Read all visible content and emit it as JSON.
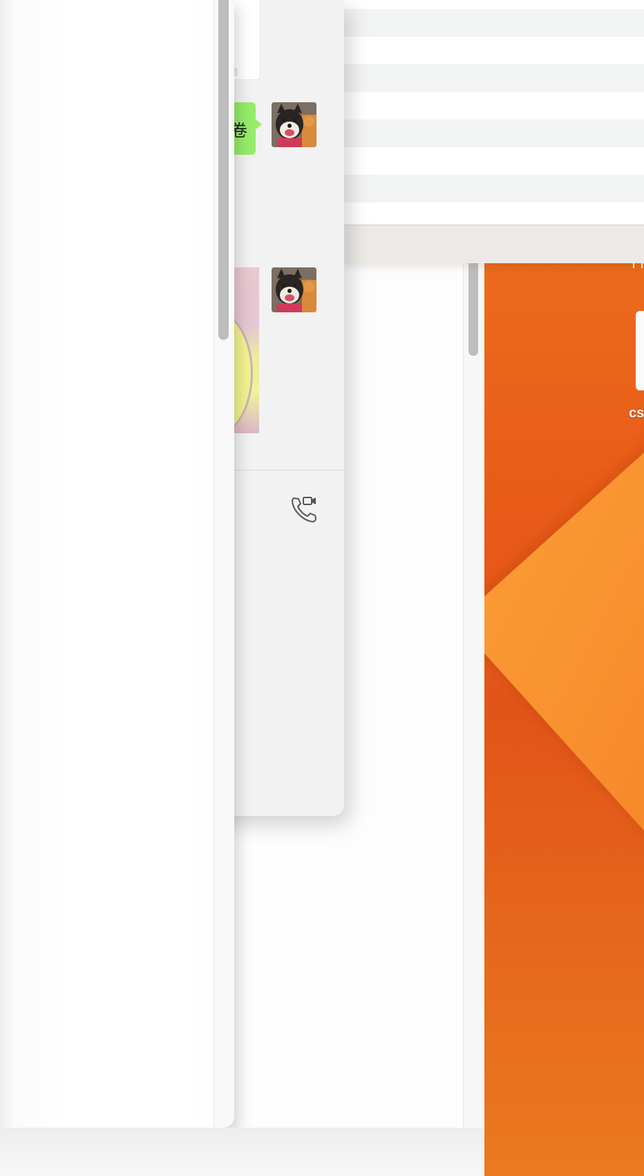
{
  "wallpaper": {
    "caption": "cs",
    "colors": {
      "orange_dark": "#e85a18",
      "orange_light": "#fb9a34"
    }
  },
  "chat": {
    "messages": [
      {
        "type": "text",
        "text": "卷",
        "bubble_color": "#95ec69",
        "avatar": "shiba-cat-avatar"
      },
      {
        "type": "image",
        "avatar": "shiba-cat-avatar"
      }
    ],
    "quoted_tail": "图",
    "call_icon": "phone-video-call-icon"
  },
  "table": {
    "stripe_colors": [
      "#f2f3f3",
      "#ffffff"
    ]
  }
}
